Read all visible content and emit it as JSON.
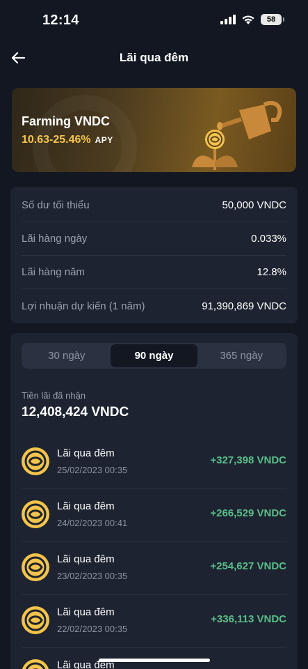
{
  "status_bar": {
    "time": "12:14",
    "battery": "58"
  },
  "nav": {
    "title": "Lãi qua đêm"
  },
  "banner": {
    "title": "Farming VNDC",
    "apy_range": "10.63-25.46%",
    "apy_label": "APY"
  },
  "info": [
    {
      "label": "Số dư tối thiểu",
      "value": "50,000 VNDC"
    },
    {
      "label": "Lãi hàng ngày",
      "value": "0.033%"
    },
    {
      "label": "Lãi hàng năm",
      "value": "12.8%"
    },
    {
      "label": "Lợi nhuận dự kiến (1 năm)",
      "value": "91,390,869 VNDC"
    }
  ],
  "tabs": [
    {
      "label": "30 ngày",
      "active": false
    },
    {
      "label": "90 ngày",
      "active": true
    },
    {
      "label": "365 ngày",
      "active": false
    }
  ],
  "earned": {
    "label": "Tiền lãi đã nhận",
    "value": "12,408,424 VNDC"
  },
  "transactions": [
    {
      "title": "Lãi qua đêm",
      "date": "25/02/2023 00:35",
      "amount": "+327,398 VNDC"
    },
    {
      "title": "Lãi qua đêm",
      "date": "24/02/2023 00:41",
      "amount": "+266,529 VNDC"
    },
    {
      "title": "Lãi qua đêm",
      "date": "23/02/2023 00:35",
      "amount": "+254,627 VNDC"
    },
    {
      "title": "Lãi qua đêm",
      "date": "22/02/2023 00:35",
      "amount": "+336,113 VNDC"
    },
    {
      "title": "Lãi qua đêm",
      "date": "",
      "amount": ""
    }
  ],
  "colors": {
    "accent_gold": "#f4c44a",
    "positive_green": "#5bbf8a",
    "background": "#121721",
    "card": "#1d2330"
  },
  "icons": {
    "back": "arrow-left-icon",
    "coin": "vndc-coin-icon",
    "watering_can": "watering-can-icon",
    "flower": "flower-coin-icon"
  }
}
